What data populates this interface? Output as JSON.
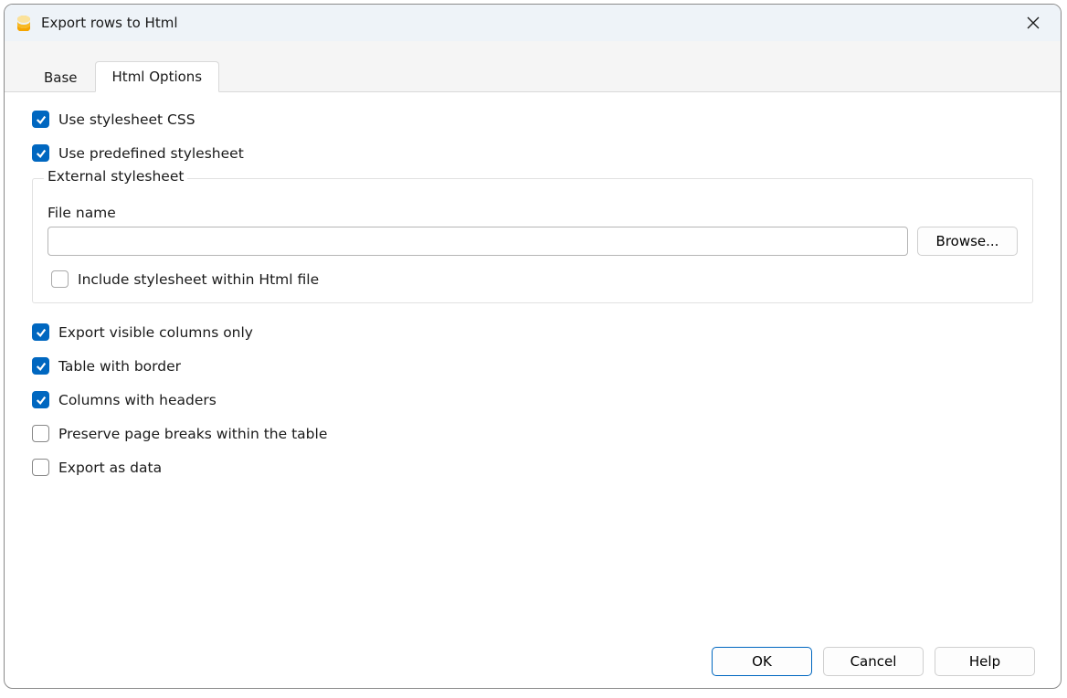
{
  "window": {
    "title": "Export rows to Html"
  },
  "tabs": {
    "base": "Base",
    "html_options": "Html Options"
  },
  "options": {
    "use_stylesheet_css": {
      "label": "Use stylesheet CSS",
      "checked": true
    },
    "use_predefined_stylesheet": {
      "label": "Use predefined stylesheet",
      "checked": true
    },
    "external_stylesheet_group": "External stylesheet",
    "file_name_label": "File name",
    "file_name_value": "",
    "browse_label": "Browse...",
    "include_within_html": {
      "label": "Include stylesheet within Html file",
      "checked": false
    },
    "export_visible_columns_only": {
      "label": "Export visible columns only",
      "checked": true
    },
    "table_with_border": {
      "label": "Table with border",
      "checked": true
    },
    "columns_with_headers": {
      "label": "Columns with headers",
      "checked": true
    },
    "preserve_page_breaks": {
      "label": "Preserve page breaks within the table",
      "checked": false
    },
    "export_as_data": {
      "label": "Export as data",
      "checked": false
    }
  },
  "buttons": {
    "ok": "OK",
    "cancel": "Cancel",
    "help": "Help"
  }
}
